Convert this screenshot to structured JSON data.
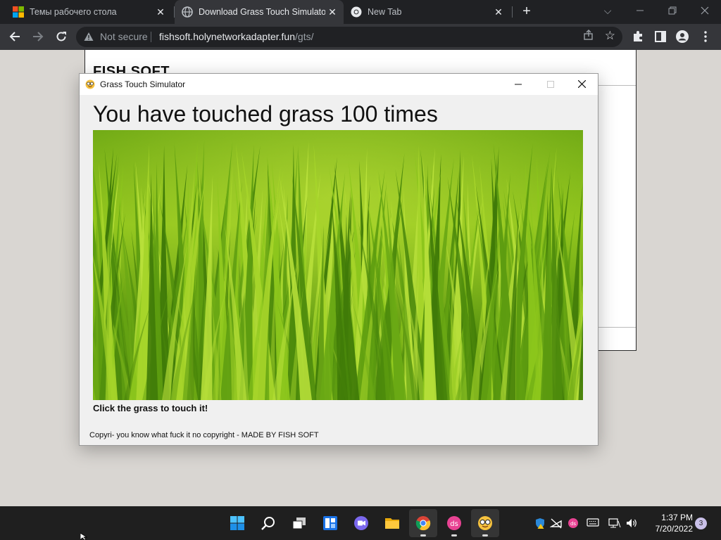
{
  "browser": {
    "tabs": [
      {
        "title": "Темы рабочего стола",
        "favicon": "windows-logo-icon"
      },
      {
        "title": "Download Grass Touch Simulator",
        "favicon": "globe-icon",
        "active": true
      },
      {
        "title": "New Tab",
        "favicon": "chrome-icon"
      }
    ],
    "close_glyph": "✕",
    "new_tab_glyph": "+",
    "omnibox": {
      "security_label": "Not secure",
      "host": "fishsoft.holynetworkadapter.fun",
      "path": "/gts/"
    }
  },
  "webpage": {
    "brand": "FISH SOFT"
  },
  "app_window": {
    "title": "Grass Touch Simulator",
    "counter_text": "You have touched grass 100 times",
    "instruction": "Click the grass to touch it!",
    "copyright": "Copyri- you know what fuck it no copyright - MADE BY FISH SOFT"
  },
  "taskbar": {
    "apps": [
      "windows-start-icon",
      "search-icon",
      "task-view-icon",
      "widgets-icon",
      "chat-icon",
      "file-explorer-icon",
      "chrome-icon",
      "ds-app-icon",
      "grass-simulator-icon"
    ],
    "time": "1:37 PM",
    "date": "7/20/2022",
    "notification_count": "3"
  },
  "colors": {
    "tabstrip": "#202124",
    "toolbar": "#35363a",
    "taskbar": "#1f1f1f",
    "window_bg": "#f0f0f0",
    "desktop": "#d9d6d2"
  }
}
